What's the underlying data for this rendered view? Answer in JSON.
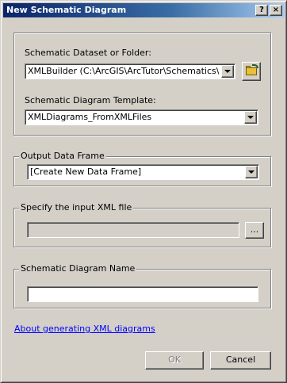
{
  "window": {
    "title": "New Schematic Diagram",
    "help_glyph": "?",
    "close_glyph": "×"
  },
  "dataset": {
    "label": "Schematic Dataset or Folder:",
    "value": "XMLBuilder (C:\\ArcGIS\\ArcTutor\\Schematics\\Tests",
    "browse_icon": "open-folder-icon"
  },
  "template": {
    "label": "Schematic Diagram Template:",
    "value": "XMLDiagrams_FromXMLFiles"
  },
  "output_frame": {
    "legend": "Output Data Frame",
    "value": "[Create New Data Frame]"
  },
  "xml_input": {
    "legend": "Specify the input XML file",
    "value": "",
    "browse_label": "..."
  },
  "diagram_name": {
    "legend": "Schematic Diagram Name",
    "value": ""
  },
  "help_link": "About generating XML diagrams",
  "buttons": {
    "ok": "OK",
    "cancel": "Cancel"
  },
  "colors": {
    "face": "#d4d0c8",
    "title_start": "#0a246a",
    "title_end": "#a6caf0",
    "link": "#0000ff"
  }
}
